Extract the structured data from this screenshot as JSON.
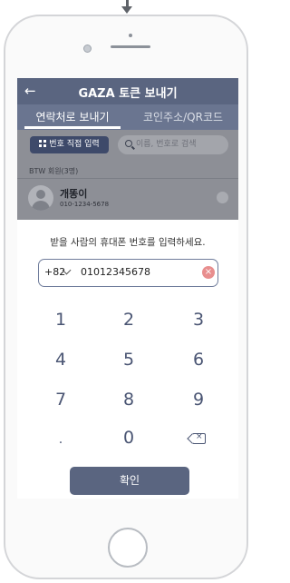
{
  "header": {
    "title": "GAZA 토큰 보내기",
    "back_icon": "arrow-left-icon"
  },
  "tabs": [
    {
      "label": "연락처로 보내기",
      "active": true
    },
    {
      "label": "코인주소/QR코드",
      "active": false
    }
  ],
  "toolbar": {
    "direct_input_label": "번호 직접 입력",
    "search_placeholder": "이름, 번호로 검색"
  },
  "contacts": {
    "group_label": "BTW 회원(3명)",
    "items": [
      {
        "name": "개똥이",
        "phone": "010-1234-5678"
      }
    ]
  },
  "sheet": {
    "prompt": "받을 사람의 휴대폰 번호를 입력하세요.",
    "country_code": "+82",
    "phone_value": "01012345678",
    "keys": [
      "1",
      "2",
      "3",
      "4",
      "5",
      "6",
      "7",
      "8",
      "9",
      ".",
      "0"
    ],
    "confirm_label": "확인"
  },
  "colors": {
    "primary": "#5a6580",
    "overlay": "#8d8f96",
    "key_text": "#4a5573",
    "clear": "#e88e8e"
  }
}
